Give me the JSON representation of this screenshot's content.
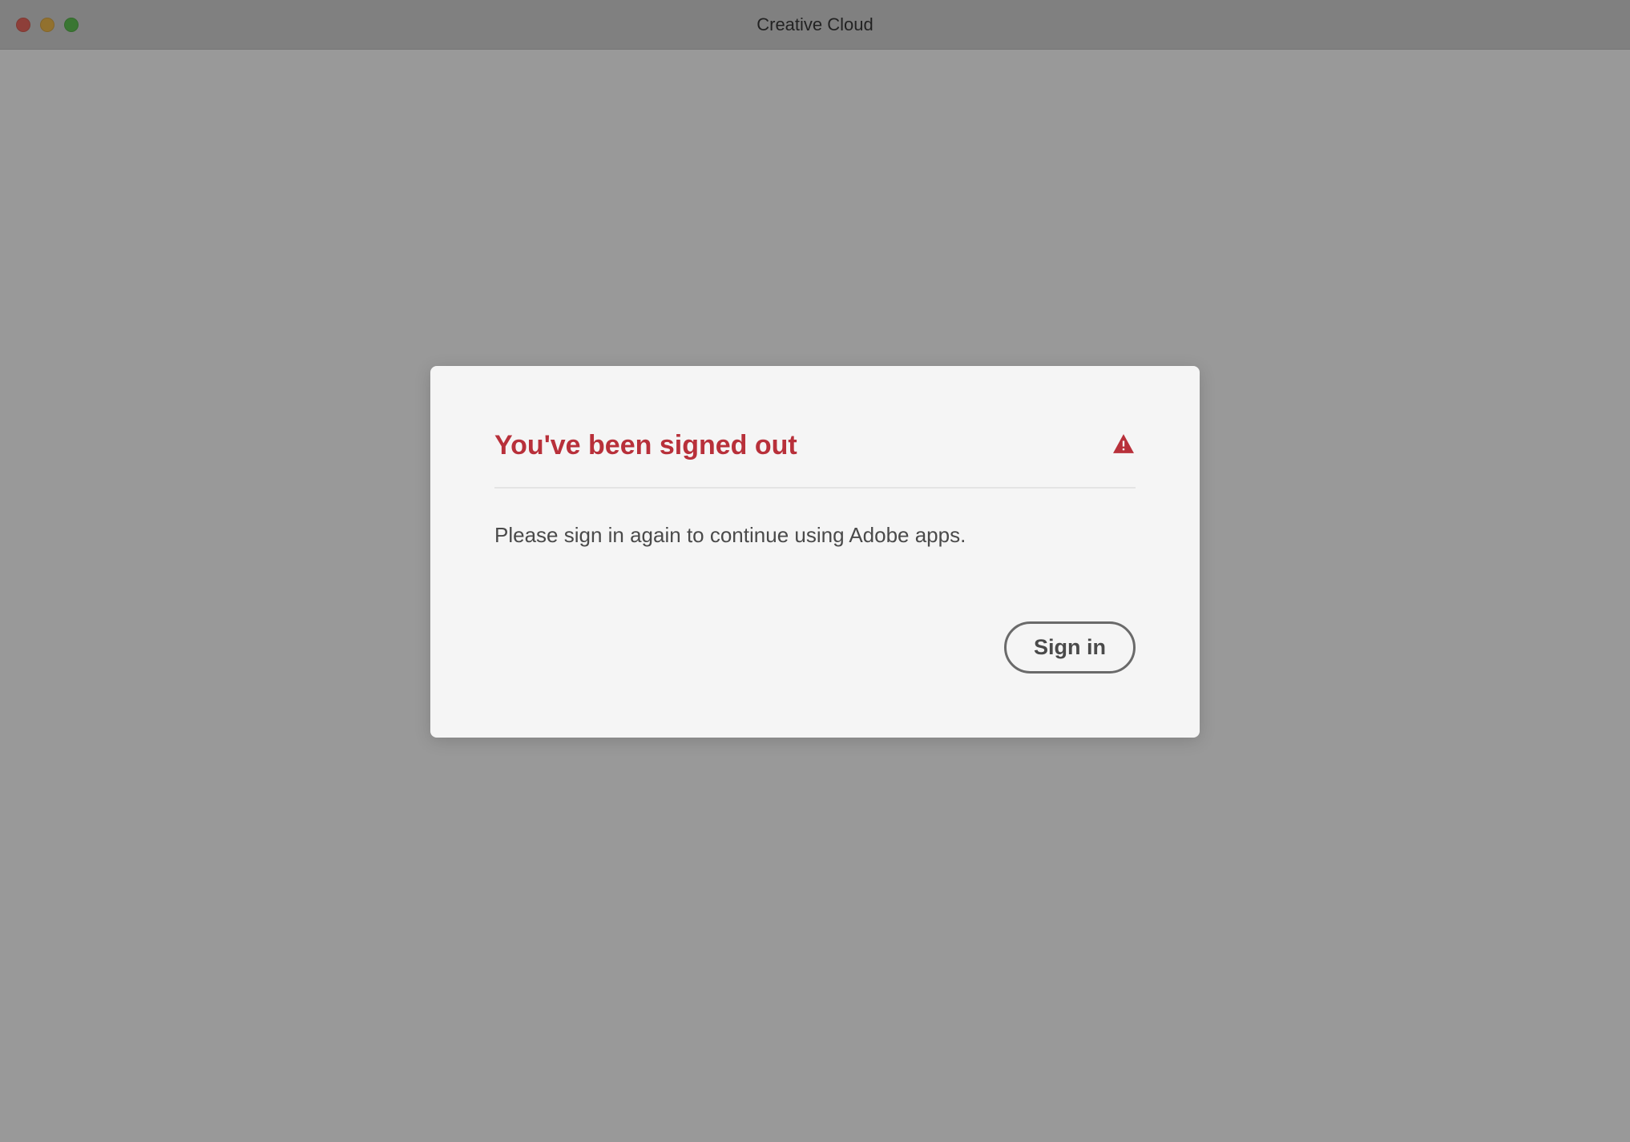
{
  "window": {
    "title": "Creative Cloud"
  },
  "dialog": {
    "title": "You've been signed out",
    "message": "Please sign in again to continue using Adobe apps.",
    "button_label": "Sign in"
  },
  "colors": {
    "alert_red": "#b8303a",
    "dialog_bg": "#f5f5f5"
  }
}
